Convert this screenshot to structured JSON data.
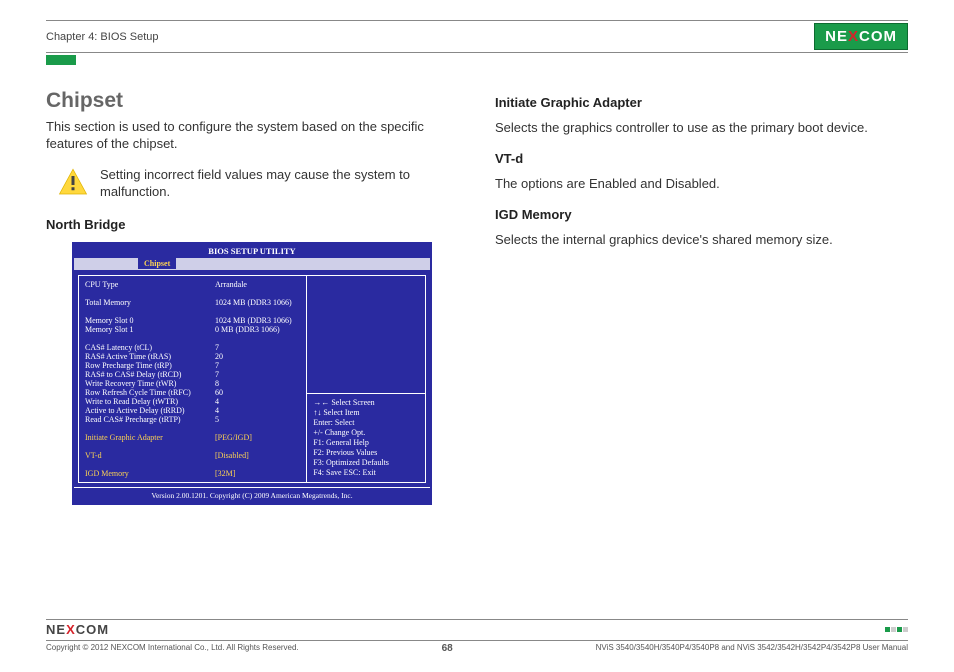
{
  "header": {
    "chapter": "Chapter 4: BIOS Setup",
    "logo_pre": "NE",
    "logo_x": "X",
    "logo_post": "COM"
  },
  "left": {
    "title": "Chipset",
    "intro": "This section is used to configure the system based on the specific features of the chipset.",
    "warning": "Setting incorrect field values may cause the system to malfunction.",
    "sub": "North Bridge"
  },
  "bios": {
    "title": "BIOS SETUP UTILITY",
    "tab": "Chipset",
    "rows_info": [
      {
        "l": "CPU Type",
        "v": "Arrandale"
      },
      {
        "l": "",
        "v": ""
      },
      {
        "l": "Total Memory",
        "v": "1024 MB (DDR3 1066)"
      },
      {
        "l": "",
        "v": ""
      },
      {
        "l": "Memory Slot 0",
        "v": "1024 MB (DDR3 1066)"
      },
      {
        "l": "Memory Slot 1",
        "v": "0 MB (DDR3 1066)"
      },
      {
        "l": "",
        "v": ""
      },
      {
        "l": "CAS# Latency (tCL)",
        "v": "7"
      },
      {
        "l": "RAS# Active Time (tRAS)",
        "v": "20"
      },
      {
        "l": "Row Precharge Time (tRP)",
        "v": "7"
      },
      {
        "l": "RAS# to CAS# Delay (tRCD)",
        "v": "7"
      },
      {
        "l": "Write Recovery Time (tWR)",
        "v": "8"
      },
      {
        "l": "Row Refresh Cycle Time (tRFC)",
        "v": "60"
      },
      {
        "l": "Write to Read Delay (tWTR)",
        "v": "4"
      },
      {
        "l": "Active to Active Delay (tRRD)",
        "v": "4"
      },
      {
        "l": "Read CAS# Precharge (tRTP)",
        "v": "5"
      }
    ],
    "opts": [
      {
        "l": "Initiate Graphic Adapter",
        "v": "[PEG/IGD]"
      },
      {
        "l": "",
        "v": ""
      },
      {
        "l": "VT-d",
        "v": "[Disabled]"
      },
      {
        "l": "",
        "v": ""
      },
      {
        "l": "IGD Memory",
        "v": "[32M]"
      }
    ],
    "help": {
      "l1": "→←   Select Screen",
      "l2": "↑↓     Select Item",
      "l3": "Enter: Select",
      "l4": "+/-     Change Opt.",
      "l5": "F1:    General Help",
      "l6": "F2:    Previous Values",
      "l7": "F3:    Optimized Defaults",
      "l8": "F4:    Save   ESC: Exit"
    },
    "footer": "Version 2.00.1201. Copyright (C) 2009 American Megatrends, Inc."
  },
  "right": {
    "h1": "Initiate Graphic Adapter",
    "p1": "Selects the graphics controller to use as the primary boot device.",
    "h2": "VT-d",
    "p2": "The options are Enabled and Disabled.",
    "h3": "IGD Memory",
    "p3": "Selects the internal graphics device's shared memory size."
  },
  "footer": {
    "copyright": "Copyright © 2012 NEXCOM International Co., Ltd. All Rights Reserved.",
    "page": "68",
    "manual": "NViS 3540/3540H/3540P4/3540P8 and NViS 3542/3542H/3542P4/3542P8 User Manual"
  }
}
